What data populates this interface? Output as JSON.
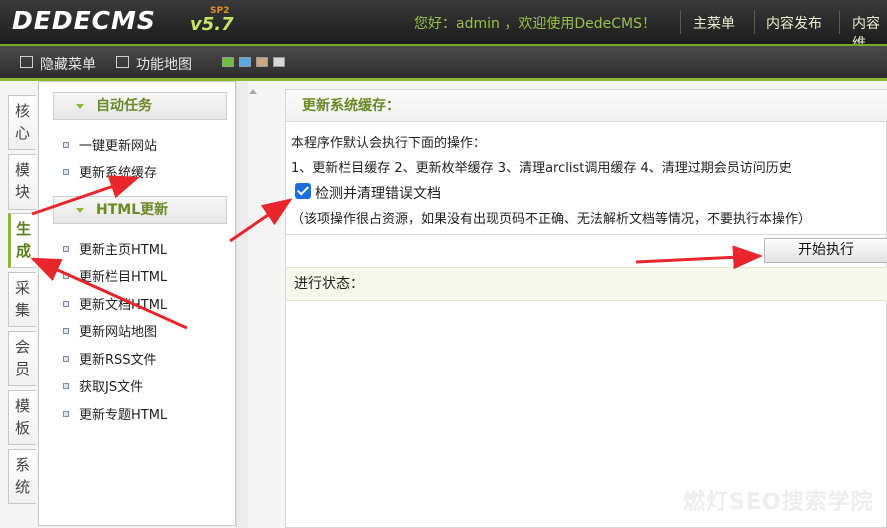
{
  "header": {
    "logo": "DEDECMS",
    "version": "v5.7",
    "version_suffix": "SP2",
    "welcome": "您好：admin ，欢迎使用DedeCMS！",
    "nav": [
      "主菜单",
      "内容发布",
      "内容维"
    ]
  },
  "toolbar": {
    "hide_menu": "隐藏菜单",
    "feature_map": "功能地图",
    "theme_swatches": [
      "#6fbf3a",
      "#57a9e0",
      "#c8a880",
      "#d8d8d8"
    ]
  },
  "side_tabs": [
    {
      "label": "核心",
      "active": false
    },
    {
      "label": "模块",
      "active": false
    },
    {
      "label": "生成",
      "active": true
    },
    {
      "label": "采集",
      "active": false
    },
    {
      "label": "会员",
      "active": false
    },
    {
      "label": "模板",
      "active": false
    },
    {
      "label": "系统",
      "active": false
    }
  ],
  "menu": {
    "auto_tasks_heading": "自动任务",
    "auto_tasks": [
      "一键更新网站",
      "更新系统缓存"
    ],
    "html_heading": "HTML更新",
    "html_items": [
      "更新主页HTML",
      "更新栏目HTML",
      "更新文档HTML",
      "更新网站地图",
      "更新RSS文件",
      "获取JS文件",
      "更新专题HTML"
    ]
  },
  "main": {
    "title": "更新系统缓存：",
    "intro": "本程序作默认会执行下面的操作：",
    "steps": "1、更新栏目缓存 2、更新枚举缓存 3、清理arclist调用缓存 4、清理过期会员访问历史",
    "checkbox_label": "检测并清理错误文档",
    "checkbox_checked": true,
    "note": "（该项操作很占资源，如果没有出现页码不正确、无法解析文档等情况，不要执行本操作）",
    "start_button": "开始执行",
    "status_label": "进行状态："
  },
  "watermark": "燃灯SEO搜索学院",
  "colors": {
    "accent_green": "#8cb832",
    "heading_green": "#6b8a26",
    "arrow_red": "#e8262b"
  }
}
